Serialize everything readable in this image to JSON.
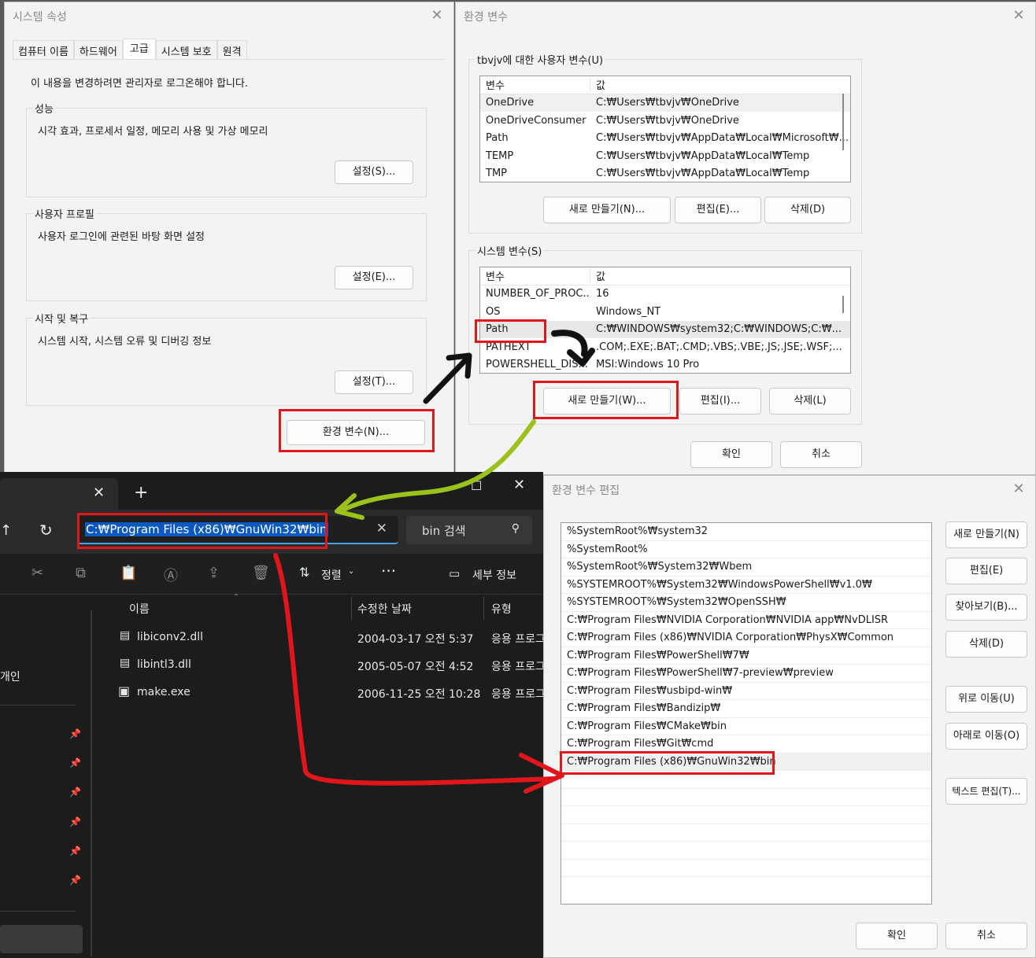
{
  "sysprops": {
    "title": "시스템 속성",
    "tabs": [
      "컴퓨터 이름",
      "하드웨어",
      "고급",
      "시스템 보호",
      "원격"
    ],
    "notice": "이 내용을 변경하려면 관리자로 로그온해야 합니다.",
    "perf_label": "성능",
    "perf_desc": "시각 효과, 프로세서 일정, 메모리 사용 및 가상 메모리",
    "perf_btn": "설정(S)...",
    "profile_label": "사용자 프로필",
    "profile_desc": "사용자 로그인에 관련된 바탕 화면 설정",
    "profile_btn": "설정(E)...",
    "startup_label": "시작 및 복구",
    "startup_desc": "시스템 시작, 시스템 오류 및 디버깅 정보",
    "startup_btn": "설정(T)...",
    "env_btn": "환경 변수(N)..."
  },
  "envvars": {
    "title": "환경 변수",
    "user_label": "tbvjv에 대한 사용자 변수(U)",
    "col_var": "변수",
    "col_val": "값",
    "user_rows": [
      {
        "name": "OneDrive",
        "value": "C:₩Users₩tbvjv₩OneDrive"
      },
      {
        "name": "OneDriveConsumer",
        "value": "C:₩Users₩tbvjv₩OneDrive"
      },
      {
        "name": "Path",
        "value": "C:₩Users₩tbvjv₩AppData₩Local₩Microsoft₩..."
      },
      {
        "name": "TEMP",
        "value": "C:₩Users₩tbvjv₩AppData₩Local₩Temp"
      },
      {
        "name": "TMP",
        "value": "C:₩Users₩tbvjv₩AppData₩Local₩Temp"
      }
    ],
    "user_new": "새로 만들기(N)...",
    "user_edit": "편집(E)...",
    "user_delete": "삭제(D)",
    "sys_label": "시스템 변수(S)",
    "sys_rows": [
      {
        "name": "NUMBER_OF_PROC...",
        "value": "16"
      },
      {
        "name": "OS",
        "value": "Windows_NT"
      },
      {
        "name": "Path",
        "value": "C:₩WINDOWS₩system32;C:₩WINDOWS;C:₩..."
      },
      {
        "name": "PATHEXT",
        "value": ".COM;.EXE;.BAT;.CMD;.VBS;.VBE;.JS;.JSE;.WSF;..."
      },
      {
        "name": "POWERSHELL_DIS...",
        "value": "MSI:Windows 10 Pro"
      }
    ],
    "sys_new": "새로 만들기(W)...",
    "sys_edit": "편집(I)...",
    "sys_delete": "삭제(L)",
    "ok": "확인",
    "cancel": "취소"
  },
  "explorer": {
    "address": "C:₩Program Files (x86)₩GnuWin32₩bin",
    "search_placeholder": "bin 검색",
    "sort": "정렬",
    "details": "세부 정보",
    "col_name": "이름",
    "col_date": "수정한 날짜",
    "col_type": "유형",
    "side_item": "개인",
    "files": [
      {
        "name": "libiconv2.dll",
        "date": "2004-03-17 오전 5:37",
        "type": "응용 프로그"
      },
      {
        "name": "libintl3.dll",
        "date": "2005-05-07 오전 4:52",
        "type": "응용 프로그"
      },
      {
        "name": "make.exe",
        "date": "2006-11-25 오전 10:28",
        "type": "응용 프로그"
      }
    ]
  },
  "editenv": {
    "title": "환경 변수 편집",
    "paths": [
      "%SystemRoot%₩system32",
      "%SystemRoot%",
      "%SystemRoot%₩System32₩Wbem",
      "%SYSTEMROOT%₩System32₩WindowsPowerShell₩v1.0₩",
      "%SYSTEMROOT%₩System32₩OpenSSH₩",
      "C:₩Program Files₩NVIDIA Corporation₩NVIDIA app₩NvDLISR",
      "C:₩Program Files (x86)₩NVIDIA Corporation₩PhysX₩Common",
      "C:₩Program Files₩PowerShell₩7₩",
      "C:₩Program Files₩PowerShell₩7-preview₩preview",
      "C:₩Program Files₩usbipd-win₩",
      "C:₩Program Files₩Bandizip₩",
      "C:₩Program Files₩CMake₩bin",
      "C:₩Program Files₩Git₩cmd",
      "C:₩Program Files (x86)₩GnuWin32₩bin"
    ],
    "btn_new": "새로 만들기(N)",
    "btn_edit": "편집(E)",
    "btn_browse": "찾아보기(B)...",
    "btn_delete": "삭제(D)",
    "btn_up": "위로 이동(U)",
    "btn_down": "아래로 이동(O)",
    "btn_text": "텍스트 편집(T)...",
    "ok": "확인",
    "cancel": "취소"
  },
  "colors": {
    "highlight": "#e0161b",
    "arrow_green": "#9ac21a",
    "selection": "#0a58c2"
  }
}
